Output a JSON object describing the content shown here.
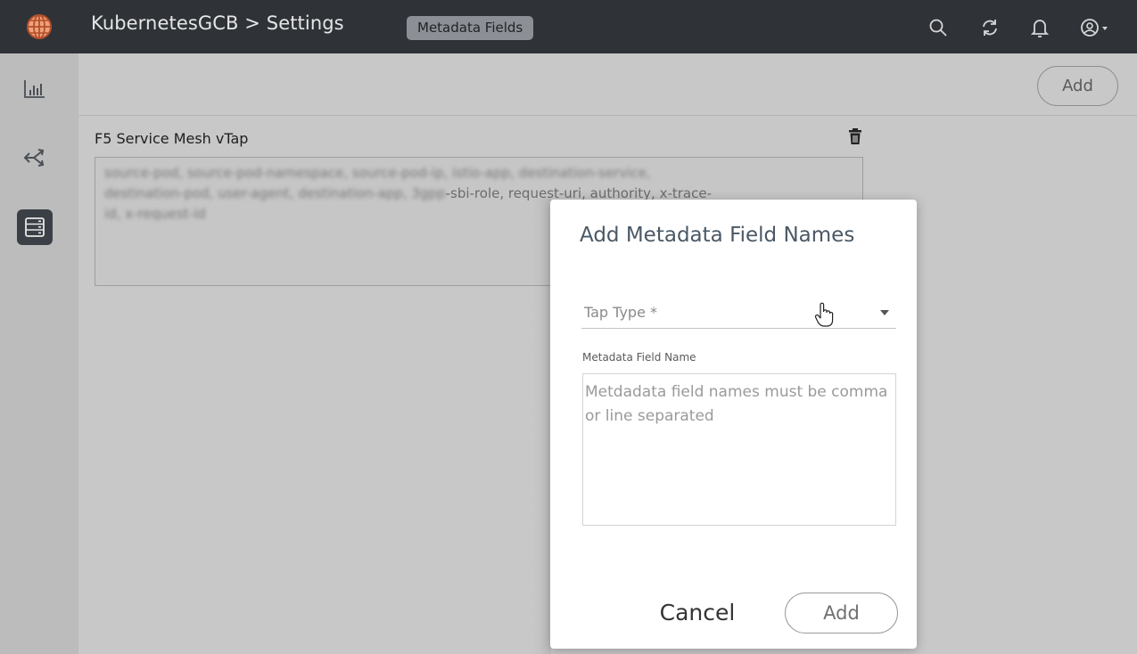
{
  "header": {
    "breadcrumb": "KubernetesGCB > Settings",
    "section_pill": "Metadata Fields",
    "icons": [
      "globe-icon",
      "search-icon",
      "refresh-icon",
      "bell-icon",
      "user-icon"
    ]
  },
  "sidebar": {
    "items": [
      {
        "icon": "bar-chart-icon"
      },
      {
        "icon": "traffic-flow-icon"
      },
      {
        "icon": "server-list-icon",
        "active": true
      }
    ]
  },
  "toolbar": {
    "add_label": "Add"
  },
  "card": {
    "title": "F5 Service Mesh vTap",
    "content_line1": "source-pod, source-pod-namespace, source-pod-ip, istio-app, destination-service,",
    "content_line2_blurred": "destination-pod, user-agent, destination-app, 3gpp",
    "content_line2_visible": "-sbi-role, request-uri, authority, x-trace-",
    "content_line3": "id, x-request-id"
  },
  "modal": {
    "title": "Add Metadata Field Names",
    "tap_type_label": "Tap Type *",
    "field_label": "Metadata Field Name",
    "placeholder": "Metdadata field names must be comma or line separated",
    "cancel_label": "Cancel",
    "add_label": "Add"
  },
  "colors": {
    "topbar": "#2f3338",
    "background": "#c8c8c8",
    "accent": "#f0a07a"
  }
}
